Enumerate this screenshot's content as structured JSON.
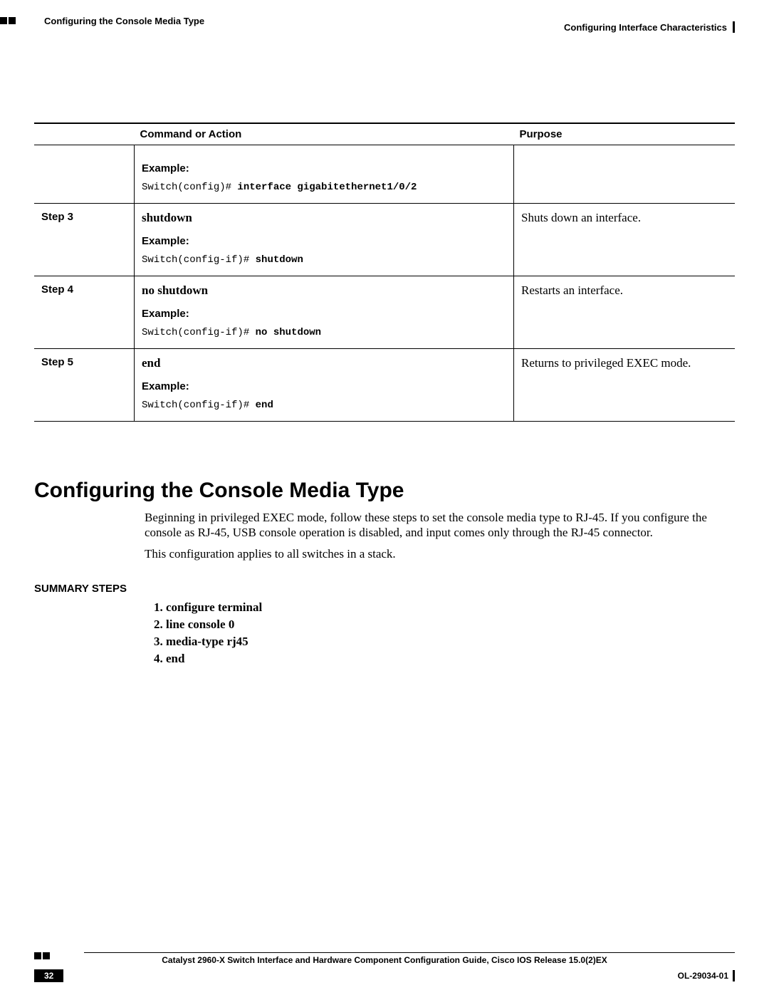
{
  "header": {
    "chapter_header": "Configuring Interface Characteristics",
    "breadcrumb": "Configuring the Console Media Type"
  },
  "table": {
    "headers": {
      "step": "",
      "command": "Command or Action",
      "purpose": "Purpose"
    },
    "rows": [
      {
        "step": "",
        "command_name": "",
        "example_label": "Example:",
        "code_prefix": "Switch(config)# ",
        "code_bold": "interface gigabitethernet1/0/2",
        "purpose": ""
      },
      {
        "step": "Step 3",
        "command_name": "shutdown",
        "example_label": "Example:",
        "code_prefix": "Switch(config-if)# ",
        "code_bold": "shutdown",
        "purpose": "Shuts down an interface."
      },
      {
        "step": "Step 4",
        "command_name": "no shutdown",
        "example_label": "Example:",
        "code_prefix": "Switch(config-if)# ",
        "code_bold": "no shutdown",
        "purpose": "Restarts an interface."
      },
      {
        "step": "Step 5",
        "command_name": "end",
        "example_label": "Example:",
        "code_prefix": "Switch(config-if)# ",
        "code_bold": "end",
        "purpose": "Returns to privileged EXEC mode."
      }
    ]
  },
  "section": {
    "heading": "Configuring the Console Media Type",
    "para1": "Beginning in privileged EXEC mode, follow these steps to set the console media type to RJ-45. If you configure the console as RJ-45, USB console operation is disabled, and input comes only through the RJ-45 connector.",
    "para2": "This configuration applies to all switches in a stack.",
    "summary_label": "SUMMARY STEPS",
    "summary_steps": [
      "configure terminal",
      "line console 0",
      "media-type rj45",
      "end"
    ]
  },
  "footer": {
    "title": "Catalyst 2960-X Switch Interface and Hardware Component Configuration Guide, Cisco IOS Release 15.0(2)EX",
    "page_number": "32",
    "doc_id": "OL-29034-01"
  }
}
